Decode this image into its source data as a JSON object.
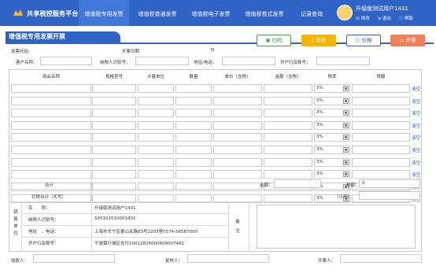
{
  "nav": {
    "brand": "共享税控服务平台",
    "tabs": [
      "增值税专用发票",
      "增值税普通发票",
      "增值税电子发票",
      "增值税卷式发票",
      "记录查询"
    ],
    "user": "升级版测试用户1431",
    "links": [
      "修改",
      "退出",
      "帮助"
    ]
  },
  "page": {
    "title": "增值税专用发票开票",
    "buttons": {
      "scan": "扫码",
      "discount": "折扣",
      "price": "价格",
      "issue": "开票"
    }
  },
  "meta": {
    "invoice_code": "发票代码:",
    "issue_date": "开票日期:",
    "number": "N",
    "customer": "客户名称：",
    "taxpayer_id": "纳税人识别号：",
    "address": "地址/电话：",
    "bank": "开户行及账号："
  },
  "table": {
    "headers": [
      "商品名称",
      "规格型号",
      "计量单位",
      "数量",
      "单价（含税）",
      "金额（含税）",
      "税率",
      "税额"
    ],
    "rows": [
      {
        "rate": "3%",
        "action": "清空"
      },
      {
        "rate": "3%",
        "action": "清空"
      },
      {
        "rate": "3%",
        "action": "清空"
      },
      {
        "rate": "3%",
        "action": "清空"
      },
      {
        "rate": "3%",
        "action": "清空"
      },
      {
        "rate": "3%",
        "action": "清空"
      },
      {
        "rate": "3%",
        "action": "清空"
      },
      {
        "rate": "3%",
        "action": "清空"
      },
      {
        "rate": "3%",
        "action": "清空"
      },
      {
        "rate": "3%",
        "action": "清空"
      }
    ],
    "total_label": "合计",
    "amount_label": "金额：",
    "tax_label": "税额：",
    "tax_value": "0",
    "total_tax_label": "价税合计（大写）",
    "lowercase_label": "（小写）："
  },
  "seller": {
    "side_label": "销售单位",
    "name_label": "名　　称：",
    "name": "升级版测试用户1431",
    "id_label": "纳税人识别号：",
    "id": "500102010001431",
    "addr_label": "地址　、电话：",
    "addr": "上海市长宁区娄山关路83号2203室0574-56587000",
    "bank_label": "开户行及账号：",
    "bank": "宁波银行城区支行10012825000609007482",
    "remark_label": "备注"
  },
  "footer": {
    "payee": "收款人：",
    "reviewer": "复核人：",
    "drawer": "开票人："
  }
}
